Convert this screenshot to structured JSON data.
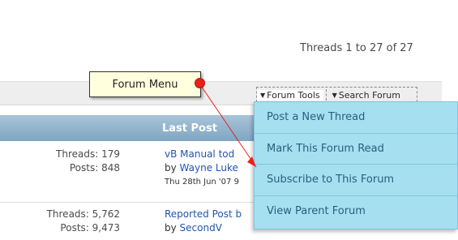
{
  "threads_count": "Threads 1 to 27 of 27",
  "toolbar": {
    "forum_tools_label": "Forum Tools",
    "search_forum_label": "Search Forum"
  },
  "table": {
    "last_post_header": "Last Post",
    "rows": [
      {
        "threads": "Threads: 179",
        "posts": "Posts: 848",
        "last_post_title": "vB Manual tod",
        "by_label": "by",
        "author": "Wayne Luke",
        "date": "Thu 28th Jun '07 9"
      },
      {
        "threads": "Threads: 5,762",
        "posts": "Posts: 9,473",
        "last_post_title": "Reported Post b",
        "by_label": "by",
        "author": "SecondV"
      }
    ]
  },
  "callout": {
    "label": "Forum Menu",
    "dot_color": "#e8221a"
  },
  "menu": {
    "items": [
      "Post a New Thread",
      "Mark This Forum Read",
      "Subscribe to This Forum",
      "View Parent Forum"
    ],
    "background_color": "#a6dff0",
    "text_color": "#2b5e80"
  },
  "colors": {
    "header_bar": "#7fa6c3",
    "link": "#2255aa"
  }
}
